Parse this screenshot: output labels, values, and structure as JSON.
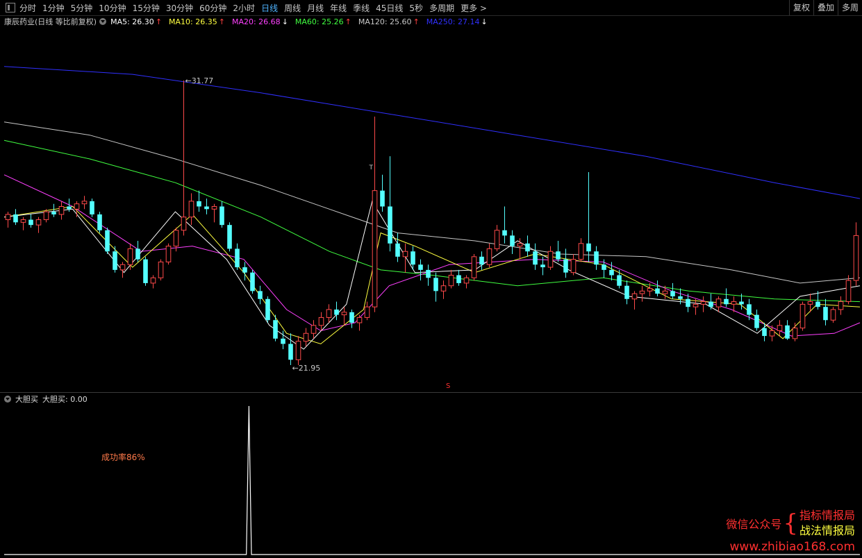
{
  "toolbar": {
    "periods": [
      {
        "label": "分时",
        "active": false
      },
      {
        "label": "1分钟",
        "active": false
      },
      {
        "label": "5分钟",
        "active": false
      },
      {
        "label": "10分钟",
        "active": false
      },
      {
        "label": "15分钟",
        "active": false
      },
      {
        "label": "30分钟",
        "active": false
      },
      {
        "label": "60分钟",
        "active": false
      },
      {
        "label": "2小时",
        "active": false
      },
      {
        "label": "日线",
        "active": true
      },
      {
        "label": "周线",
        "active": false
      },
      {
        "label": "月线",
        "active": false
      },
      {
        "label": "年线",
        "active": false
      },
      {
        "label": "季线",
        "active": false
      },
      {
        "label": "45日线",
        "active": false
      },
      {
        "label": "5秒",
        "active": false
      },
      {
        "label": "多周期",
        "active": false
      },
      {
        "label": "更多 >",
        "active": false
      }
    ],
    "right_buttons": [
      "复权",
      "叠加",
      "多周"
    ]
  },
  "legend": {
    "title": "康辰药业(日线 等比前复权)",
    "ma": [
      {
        "label": "MA5: 26.30",
        "arrow": "↑",
        "color": "#ffffff",
        "dir": "up"
      },
      {
        "label": "MA10: 26.35",
        "arrow": "↑",
        "color": "#ffff40",
        "dir": "up"
      },
      {
        "label": "MA20: 26.68",
        "arrow": "↓",
        "color": "#ff40ff",
        "dir": "dn"
      },
      {
        "label": "MA60: 25.26",
        "arrow": "↑",
        "color": "#40ff40",
        "dir": "up"
      },
      {
        "label": "MA120: 25.60",
        "arrow": "↑",
        "color": "#c8c8c8",
        "dir": "up"
      },
      {
        "label": "MA250: 27.14",
        "arrow": "↓",
        "color": "#3030ff",
        "dir": "dn"
      }
    ]
  },
  "chart_data": [
    {
      "type": "candlestick",
      "title": "康辰药业(日线 等比前复权)",
      "ylim": [
        20.5,
        33.5
      ],
      "annotations": {
        "high_label": "31.77",
        "low_label": "21.95",
        "t_mark": "T",
        "s_mark": "S"
      },
      "colors": {
        "up": "#ff4a4a",
        "down": "#54ffff"
      },
      "candles": [
        [
          26.5,
          26.8,
          26.2,
          26.7
        ],
        [
          26.7,
          26.9,
          26.3,
          26.4
        ],
        [
          26.4,
          26.6,
          26.1,
          26.5
        ],
        [
          26.5,
          26.7,
          26.2,
          26.3
        ],
        [
          26.3,
          26.6,
          26.0,
          26.5
        ],
        [
          26.5,
          26.9,
          26.4,
          26.8
        ],
        [
          26.8,
          27.1,
          26.6,
          26.7
        ],
        [
          26.7,
          27.2,
          26.5,
          27.0
        ],
        [
          27.0,
          27.3,
          26.8,
          26.9
        ],
        [
          26.9,
          27.2,
          26.6,
          27.1
        ],
        [
          27.1,
          27.4,
          26.9,
          27.2
        ],
        [
          27.2,
          27.3,
          26.6,
          26.7
        ],
        [
          26.7,
          26.8,
          26.0,
          26.1
        ],
        [
          26.1,
          26.2,
          25.2,
          25.3
        ],
        [
          25.3,
          25.5,
          24.5,
          24.6
        ],
        [
          24.6,
          24.9,
          24.3,
          24.8
        ],
        [
          24.8,
          25.6,
          24.6,
          25.4
        ],
        [
          25.4,
          25.7,
          24.9,
          25.0
        ],
        [
          25.0,
          25.1,
          24.0,
          24.1
        ],
        [
          24.1,
          24.4,
          23.9,
          24.3
        ],
        [
          24.3,
          25.0,
          24.2,
          24.9
        ],
        [
          24.9,
          25.6,
          24.8,
          25.5
        ],
        [
          25.5,
          26.2,
          25.3,
          26.1
        ],
        [
          26.1,
          31.77,
          25.9,
          26.6
        ],
        [
          26.6,
          27.5,
          26.3,
          27.2
        ],
        [
          27.2,
          27.6,
          26.8,
          27.0
        ],
        [
          27.0,
          27.3,
          26.7,
          26.9
        ],
        [
          26.9,
          27.1,
          26.4,
          27.0
        ],
        [
          27.0,
          27.2,
          26.2,
          26.3
        ],
        [
          26.3,
          26.4,
          25.3,
          25.4
        ],
        [
          25.4,
          25.6,
          24.6,
          24.7
        ],
        [
          24.7,
          24.9,
          24.2,
          24.5
        ],
        [
          24.5,
          24.6,
          23.7,
          23.8
        ],
        [
          23.8,
          24.0,
          23.3,
          23.5
        ],
        [
          23.5,
          23.6,
          22.6,
          22.7
        ],
        [
          22.7,
          22.9,
          21.9,
          22.0
        ],
        [
          22.0,
          22.3,
          21.6,
          21.8
        ],
        [
          21.8,
          22.2,
          21.0,
          21.2
        ],
        [
          21.2,
          22.1,
          21.0,
          21.9
        ],
        [
          21.9,
          22.4,
          21.7,
          22.2
        ],
        [
          22.2,
          22.7,
          22.0,
          22.5
        ],
        [
          22.5,
          23.0,
          22.3,
          22.8
        ],
        [
          22.8,
          23.3,
          22.6,
          23.1
        ],
        [
          23.1,
          23.4,
          22.7,
          22.9
        ],
        [
          22.9,
          23.2,
          22.5,
          23.0
        ],
        [
          23.0,
          23.1,
          22.4,
          22.6
        ],
        [
          22.6,
          22.9,
          22.3,
          22.8
        ],
        [
          22.8,
          23.4,
          22.7,
          23.2
        ],
        [
          23.2,
          30.4,
          23.0,
          27.6
        ],
        [
          27.6,
          28.2,
          26.8,
          27.0
        ],
        [
          27.0,
          28.9,
          25.3,
          25.6
        ],
        [
          25.6,
          26.0,
          24.9,
          25.1
        ],
        [
          25.1,
          25.6,
          24.5,
          25.3
        ],
        [
          25.3,
          25.5,
          24.6,
          24.8
        ],
        [
          24.8,
          25.0,
          24.2,
          24.6
        ],
        [
          24.6,
          24.8,
          24.0,
          24.3
        ],
        [
          24.3,
          24.5,
          23.4,
          23.8
        ],
        [
          23.8,
          24.2,
          23.5,
          24.0
        ],
        [
          24.0,
          24.6,
          23.9,
          24.4
        ],
        [
          24.4,
          24.6,
          24.0,
          24.1
        ],
        [
          24.1,
          24.4,
          23.9,
          24.3
        ],
        [
          24.3,
          25.2,
          24.2,
          25.1
        ],
        [
          25.1,
          25.3,
          24.6,
          24.8
        ],
        [
          24.8,
          25.6,
          24.7,
          25.4
        ],
        [
          25.4,
          26.3,
          25.3,
          26.1
        ],
        [
          26.1,
          27.0,
          25.6,
          25.9
        ],
        [
          25.9,
          26.1,
          25.2,
          25.5
        ],
        [
          25.5,
          25.8,
          25.0,
          25.6
        ],
        [
          25.6,
          25.9,
          25.1,
          25.3
        ],
        [
          25.3,
          25.6,
          24.6,
          24.8
        ],
        [
          24.8,
          25.1,
          24.4,
          24.7
        ],
        [
          24.7,
          25.5,
          24.6,
          25.3
        ],
        [
          25.3,
          25.7,
          24.9,
          25.0
        ],
        [
          25.0,
          25.4,
          24.3,
          24.5
        ],
        [
          24.5,
          25.2,
          24.4,
          25.0
        ],
        [
          25.0,
          25.8,
          24.9,
          25.6
        ],
        [
          25.6,
          28.3,
          24.9,
          25.3
        ],
        [
          25.3,
          25.5,
          24.6,
          24.8
        ],
        [
          24.8,
          25.0,
          24.3,
          24.6
        ],
        [
          24.6,
          24.9,
          24.2,
          24.4
        ],
        [
          24.4,
          24.6,
          23.9,
          24.0
        ],
        [
          24.0,
          24.2,
          23.3,
          23.5
        ],
        [
          23.5,
          23.8,
          23.1,
          23.7
        ],
        [
          23.7,
          24.0,
          23.4,
          23.8
        ],
        [
          23.8,
          24.1,
          23.6,
          23.9
        ],
        [
          23.9,
          24.2,
          23.6,
          23.7
        ],
        [
          23.7,
          24.0,
          23.5,
          23.8
        ],
        [
          23.8,
          24.1,
          23.5,
          23.6
        ],
        [
          23.6,
          23.9,
          23.3,
          23.5
        ],
        [
          23.5,
          23.7,
          23.0,
          23.2
        ],
        [
          23.2,
          23.5,
          22.9,
          23.3
        ],
        [
          23.3,
          23.6,
          23.0,
          23.4
        ],
        [
          23.4,
          23.7,
          23.1,
          23.2
        ],
        [
          23.2,
          23.6,
          23.0,
          23.5
        ],
        [
          23.5,
          23.9,
          23.2,
          23.3
        ],
        [
          23.3,
          23.6,
          23.0,
          23.4
        ],
        [
          23.4,
          23.7,
          23.1,
          23.3
        ],
        [
          23.3,
          23.5,
          22.7,
          22.9
        ],
        [
          22.9,
          23.1,
          22.3,
          22.4
        ],
        [
          22.4,
          22.6,
          21.9,
          22.1
        ],
        [
          22.1,
          22.5,
          21.9,
          22.3
        ],
        [
          22.3,
          22.7,
          22.1,
          22.5
        ],
        [
          22.5,
          22.7,
          21.95,
          22.0
        ],
        [
          22.0,
          22.6,
          21.9,
          22.4
        ],
        [
          22.4,
          23.4,
          22.3,
          23.3
        ],
        [
          23.3,
          23.7,
          23.0,
          23.4
        ],
        [
          23.4,
          23.8,
          23.1,
          23.2
        ],
        [
          23.2,
          23.5,
          22.5,
          22.7
        ],
        [
          22.7,
          23.2,
          22.6,
          23.1
        ],
        [
          23.1,
          23.6,
          22.9,
          23.4
        ],
        [
          23.4,
          24.4,
          23.3,
          24.2
        ],
        [
          24.2,
          26.4,
          24.0,
          25.9
        ]
      ],
      "moving_averages": [
        {
          "name": "MA250",
          "color": "#3030ff",
          "points": [
            [
              0,
              32.3
            ],
            [
              0.15,
              32.0
            ],
            [
              0.3,
              31.3
            ],
            [
              0.45,
              30.5
            ],
            [
              0.6,
              29.7
            ],
            [
              0.75,
              28.9
            ],
            [
              0.9,
              27.9
            ],
            [
              1,
              27.3
            ]
          ]
        },
        {
          "name": "MA120",
          "color": "#c8c8c8",
          "points": [
            [
              0,
              30.2
            ],
            [
              0.1,
              29.7
            ],
            [
              0.2,
              28.8
            ],
            [
              0.3,
              27.8
            ],
            [
              0.38,
              26.9
            ],
            [
              0.46,
              26.0
            ],
            [
              0.55,
              25.7
            ],
            [
              0.65,
              25.2
            ],
            [
              0.75,
              25.1
            ],
            [
              0.85,
              24.6
            ],
            [
              0.93,
              24.1
            ],
            [
              1,
              24.3
            ]
          ]
        },
        {
          "name": "MA60",
          "color": "#40ff40",
          "points": [
            [
              0,
              29.5
            ],
            [
              0.1,
              28.8
            ],
            [
              0.2,
              27.9
            ],
            [
              0.3,
              26.6
            ],
            [
              0.38,
              25.3
            ],
            [
              0.44,
              24.6
            ],
            [
              0.5,
              24.4
            ],
            [
              0.6,
              24.0
            ],
            [
              0.7,
              24.3
            ],
            [
              0.8,
              23.8
            ],
            [
              0.9,
              23.5
            ],
            [
              1,
              23.4
            ]
          ]
        },
        {
          "name": "MA20",
          "color": "#ff40ff",
          "points": [
            [
              0,
              28.2
            ],
            [
              0.08,
              27.0
            ],
            [
              0.16,
              25.3
            ],
            [
              0.22,
              25.5
            ],
            [
              0.28,
              25.0
            ],
            [
              0.33,
              23.1
            ],
            [
              0.37,
              22.3
            ],
            [
              0.41,
              22.6
            ],
            [
              0.45,
              24.0
            ],
            [
              0.52,
              24.8
            ],
            [
              0.62,
              25.0
            ],
            [
              0.7,
              24.9
            ],
            [
              0.78,
              23.8
            ],
            [
              0.85,
              23.1
            ],
            [
              0.92,
              22.1
            ],
            [
              0.97,
              22.2
            ],
            [
              1,
              22.6
            ]
          ]
        },
        {
          "name": "MA10",
          "color": "#ffff40",
          "points": [
            [
              0,
              26.6
            ],
            [
              0.08,
              27.0
            ],
            [
              0.15,
              24.7
            ],
            [
              0.22,
              26.7
            ],
            [
              0.28,
              24.5
            ],
            [
              0.33,
              22.2
            ],
            [
              0.37,
              21.8
            ],
            [
              0.42,
              23.1
            ],
            [
              0.44,
              26.0
            ],
            [
              0.48,
              25.5
            ],
            [
              0.55,
              24.5
            ],
            [
              0.62,
              25.2
            ],
            [
              0.7,
              24.8
            ],
            [
              0.78,
              23.5
            ],
            [
              0.86,
              23.3
            ],
            [
              0.91,
              22.0
            ],
            [
              0.95,
              23.3
            ],
            [
              1,
              23.2
            ]
          ]
        },
        {
          "name": "MA5",
          "color": "#ffffff",
          "points": [
            [
              0,
              26.6
            ],
            [
              0.08,
              26.9
            ],
            [
              0.14,
              24.5
            ],
            [
              0.2,
              26.8
            ],
            [
              0.26,
              25.0
            ],
            [
              0.31,
              22.5
            ],
            [
              0.35,
              21.6
            ],
            [
              0.4,
              23.3
            ],
            [
              0.43,
              27.2
            ],
            [
              0.48,
              24.5
            ],
            [
              0.55,
              24.6
            ],
            [
              0.6,
              25.7
            ],
            [
              0.66,
              24.6
            ],
            [
              0.73,
              23.6
            ],
            [
              0.82,
              23.3
            ],
            [
              0.88,
              22.2
            ],
            [
              0.93,
              23.6
            ],
            [
              1,
              24.0
            ]
          ]
        }
      ]
    },
    {
      "type": "line",
      "title": "大胆买",
      "series": [
        {
          "name": "大胆买",
          "color": "#ffffff",
          "values": [
            [
              0.283,
              0
            ],
            [
              0.286,
              1
            ],
            [
              0.289,
              0
            ]
          ]
        }
      ],
      "ylim": [
        0,
        1
      ]
    }
  ],
  "sub_panel": {
    "name": "大胆买",
    "value_label": "大胆买: 0.00",
    "note": "成功率86%"
  },
  "watermark": {
    "gzh": "微信公众号",
    "brace": "{",
    "name1": "指标情报局",
    "name2": "战法情报局",
    "url": "www.zhibiao168.com"
  }
}
